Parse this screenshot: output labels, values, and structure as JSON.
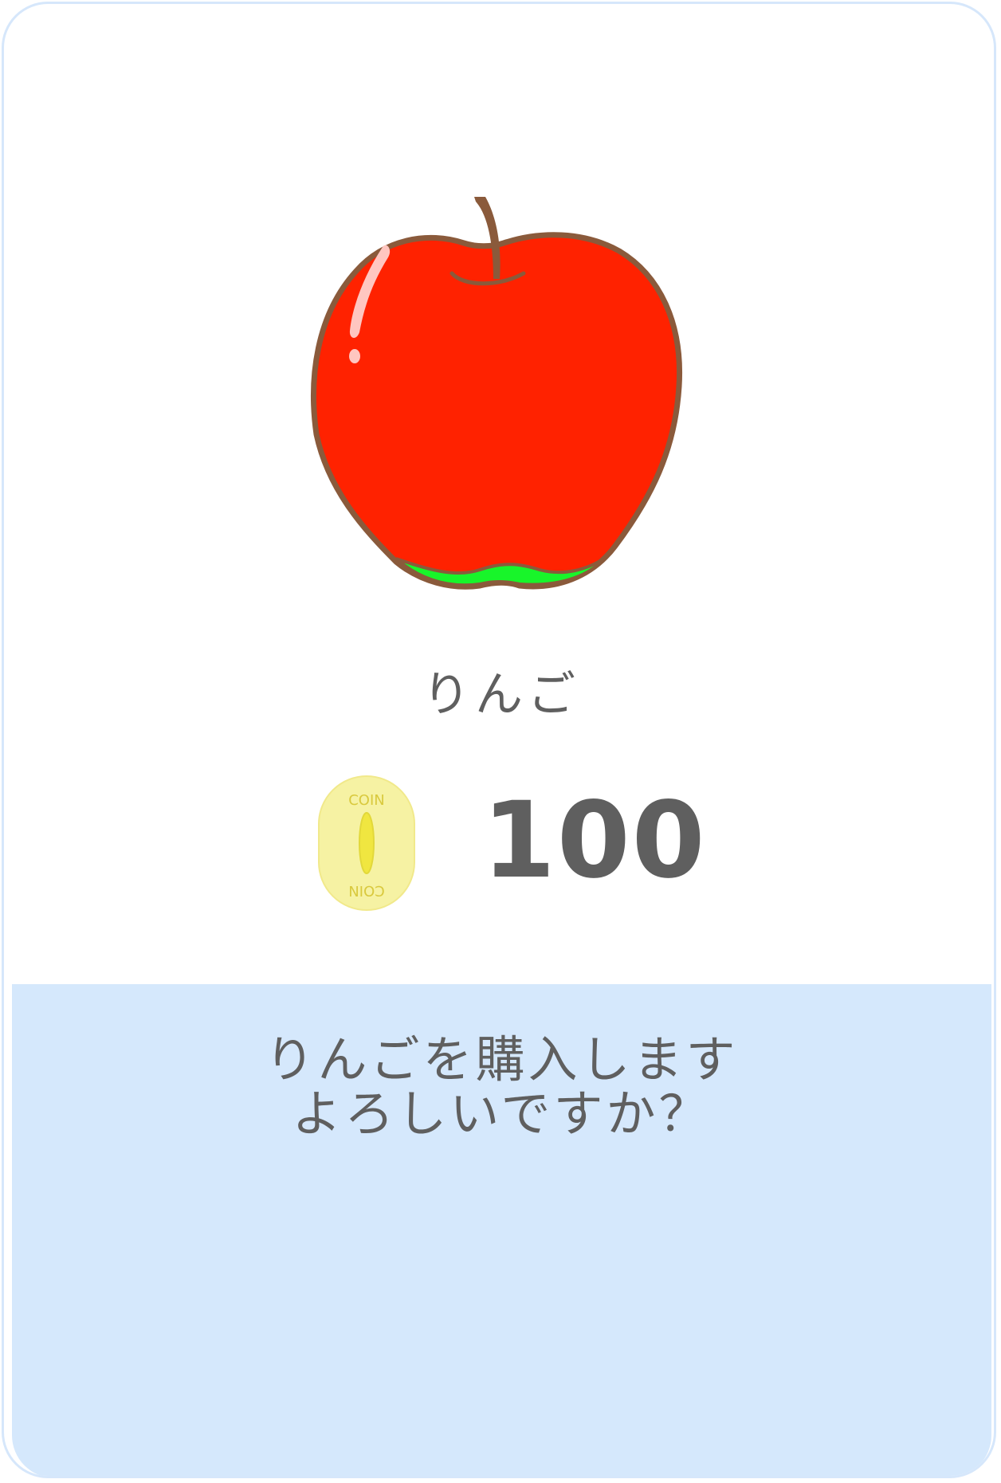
{
  "item": {
    "name": "りんご",
    "icon": "apple-icon"
  },
  "price": {
    "currency_icon": "coin-icon",
    "coin_label_top": "COIN",
    "coin_label_bottom": "COIN",
    "amount": "100"
  },
  "dialog": {
    "line1": "りんごを購入します",
    "line2": "よろしいですか？"
  },
  "colors": {
    "panel": "#d5e8fc",
    "border": "#d6e7fb",
    "text": "#5f5f5f",
    "apple_red": "#ff2200",
    "apple_outline": "#8a5a3b",
    "apple_green": "#18f52a",
    "coin_fill": "#f6f2a3",
    "coin_accent": "#f0e640"
  }
}
